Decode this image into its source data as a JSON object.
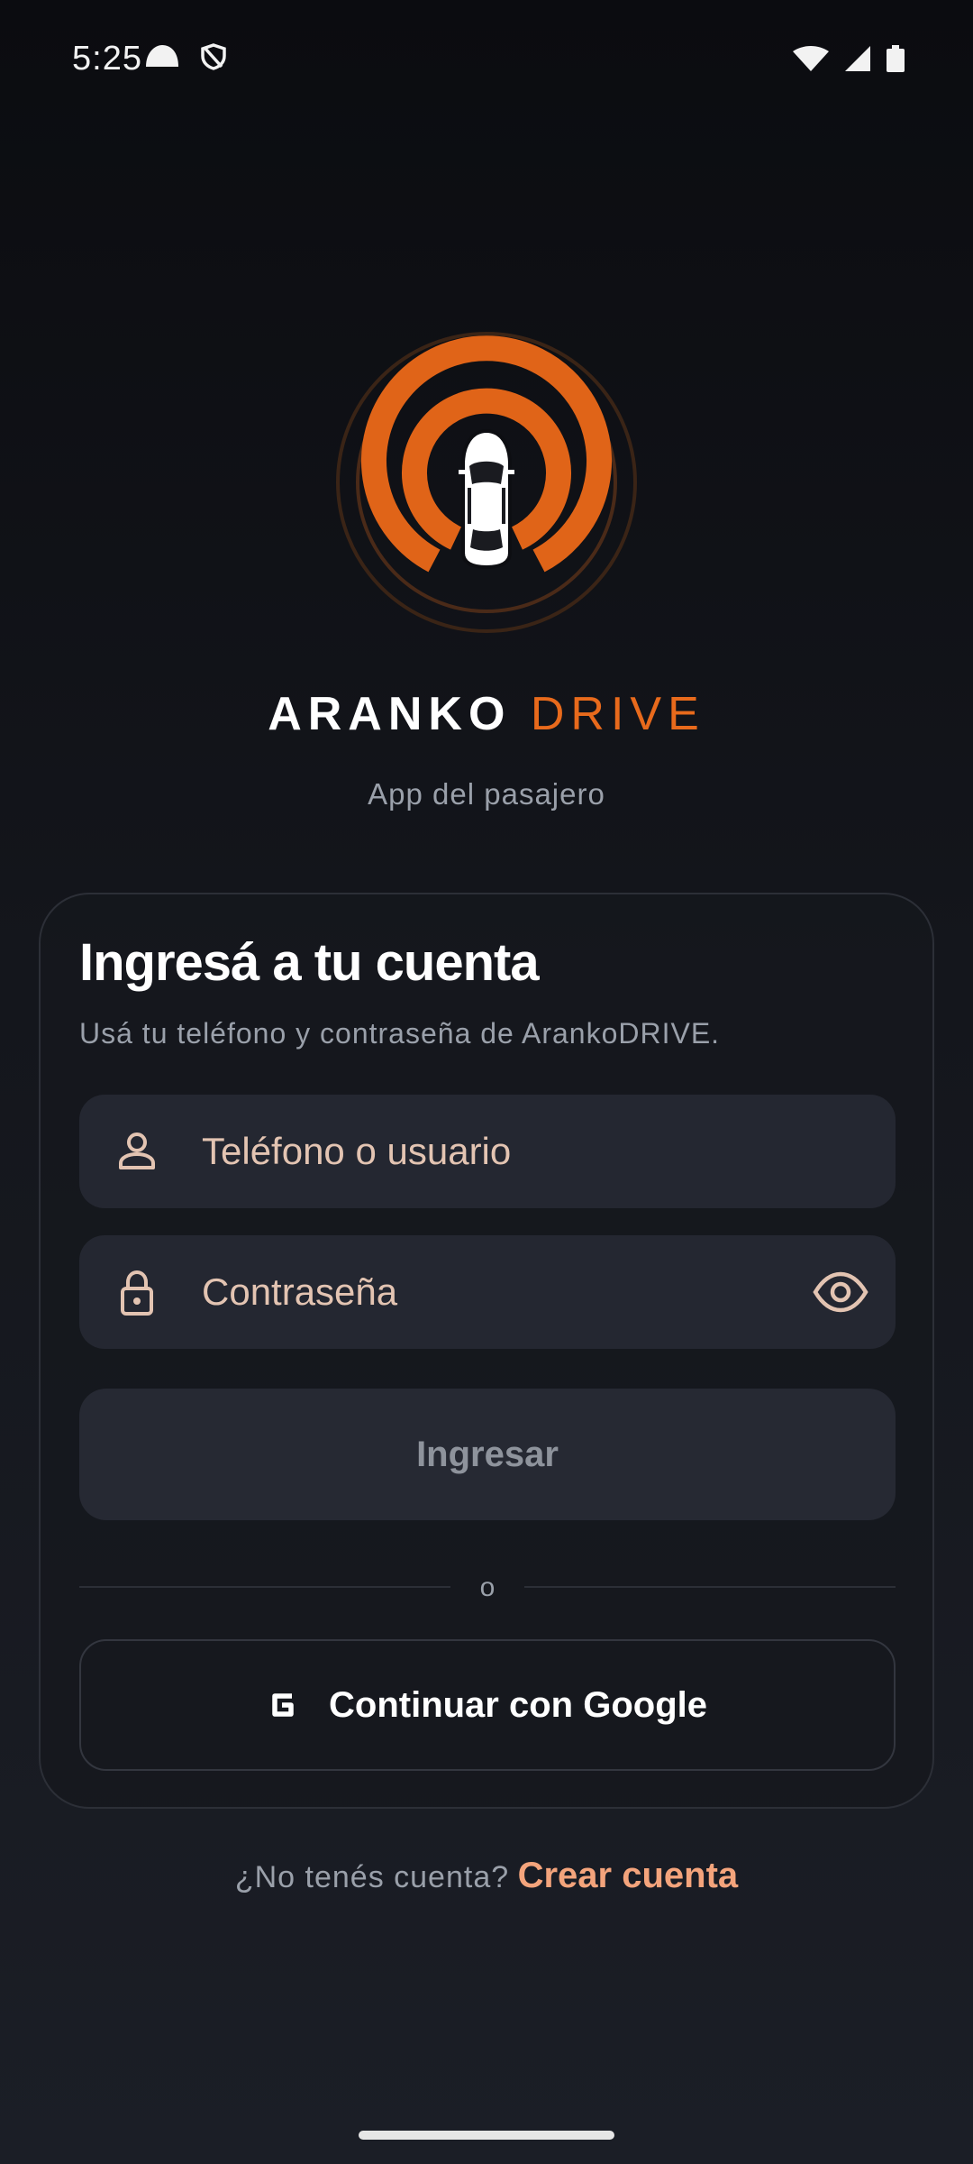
{
  "status_bar": {
    "time": "5:25",
    "left_icons": [
      "cloud-icon",
      "shield-icon"
    ],
    "right_icons": [
      "wifi-icon",
      "signal-icon",
      "battery-icon"
    ]
  },
  "brand": {
    "name_part1": "ARANKO",
    "name_part2": "DRIVE",
    "subtitle": "App del pasajero",
    "accent_color": "#e86a1c"
  },
  "login_card": {
    "title": "Ingresá a tu cuenta",
    "description": "Usá tu teléfono y contraseña de ArankoDRIVE.",
    "username_field": {
      "placeholder": "Teléfono o usuario",
      "value": "",
      "icon": "person-icon"
    },
    "password_field": {
      "placeholder": "Contraseña",
      "value": "",
      "icon": "lock-icon",
      "toggle_icon": "eye-icon"
    },
    "submit_label": "Ingresar",
    "divider_text": "o",
    "google_label": "Continuar con Google",
    "google_icon": "google-g-icon"
  },
  "footer": {
    "question": "¿No tenés cuenta?",
    "link_label": "Crear cuenta",
    "link_color": "#f4a47c"
  }
}
